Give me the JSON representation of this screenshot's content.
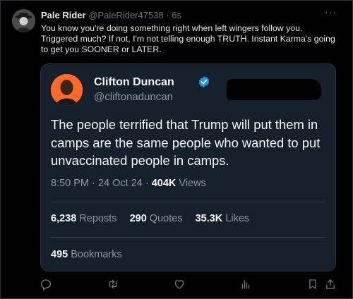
{
  "post": {
    "display_name": "Pale Rider",
    "handle": "@PaleRider47538",
    "separator": "·",
    "time": "6s",
    "text": "You know you're doing something right when left wingers follow you. Triggered much? If not, I'm not telling enough TRUTH.  Instant Karma's going to get you SOONER or LATER.",
    "more_label": "···"
  },
  "quoted": {
    "display_name": "Clifton Duncan",
    "handle": "@cliftonaduncan",
    "text": "The people terrified that Trump will put them in camps are the same people who wanted to put unvaccinated people in camps.",
    "time": "8:50 PM",
    "date": "24 Oct 24",
    "views_count": "404K",
    "views_label": "Views",
    "dot": "·",
    "reposts_count": "6,238",
    "reposts_label": "Reposts",
    "quotes_count": "290",
    "quotes_label": "Quotes",
    "likes_count": "35.3K",
    "likes_label": "Likes",
    "bookmarks_count": "495",
    "bookmarks_label": "Bookmarks"
  },
  "icons": {
    "verified": "verified-badge-icon",
    "reply": "reply-icon",
    "repost": "repost-icon",
    "like": "heart-icon",
    "views": "views-chart-icon",
    "bookmark": "bookmark-icon",
    "share": "share-icon"
  },
  "colors": {
    "background": "#000000",
    "quote_card": "#15202b",
    "verified": "#1d9bf0",
    "secondary_text": "#71767b"
  }
}
